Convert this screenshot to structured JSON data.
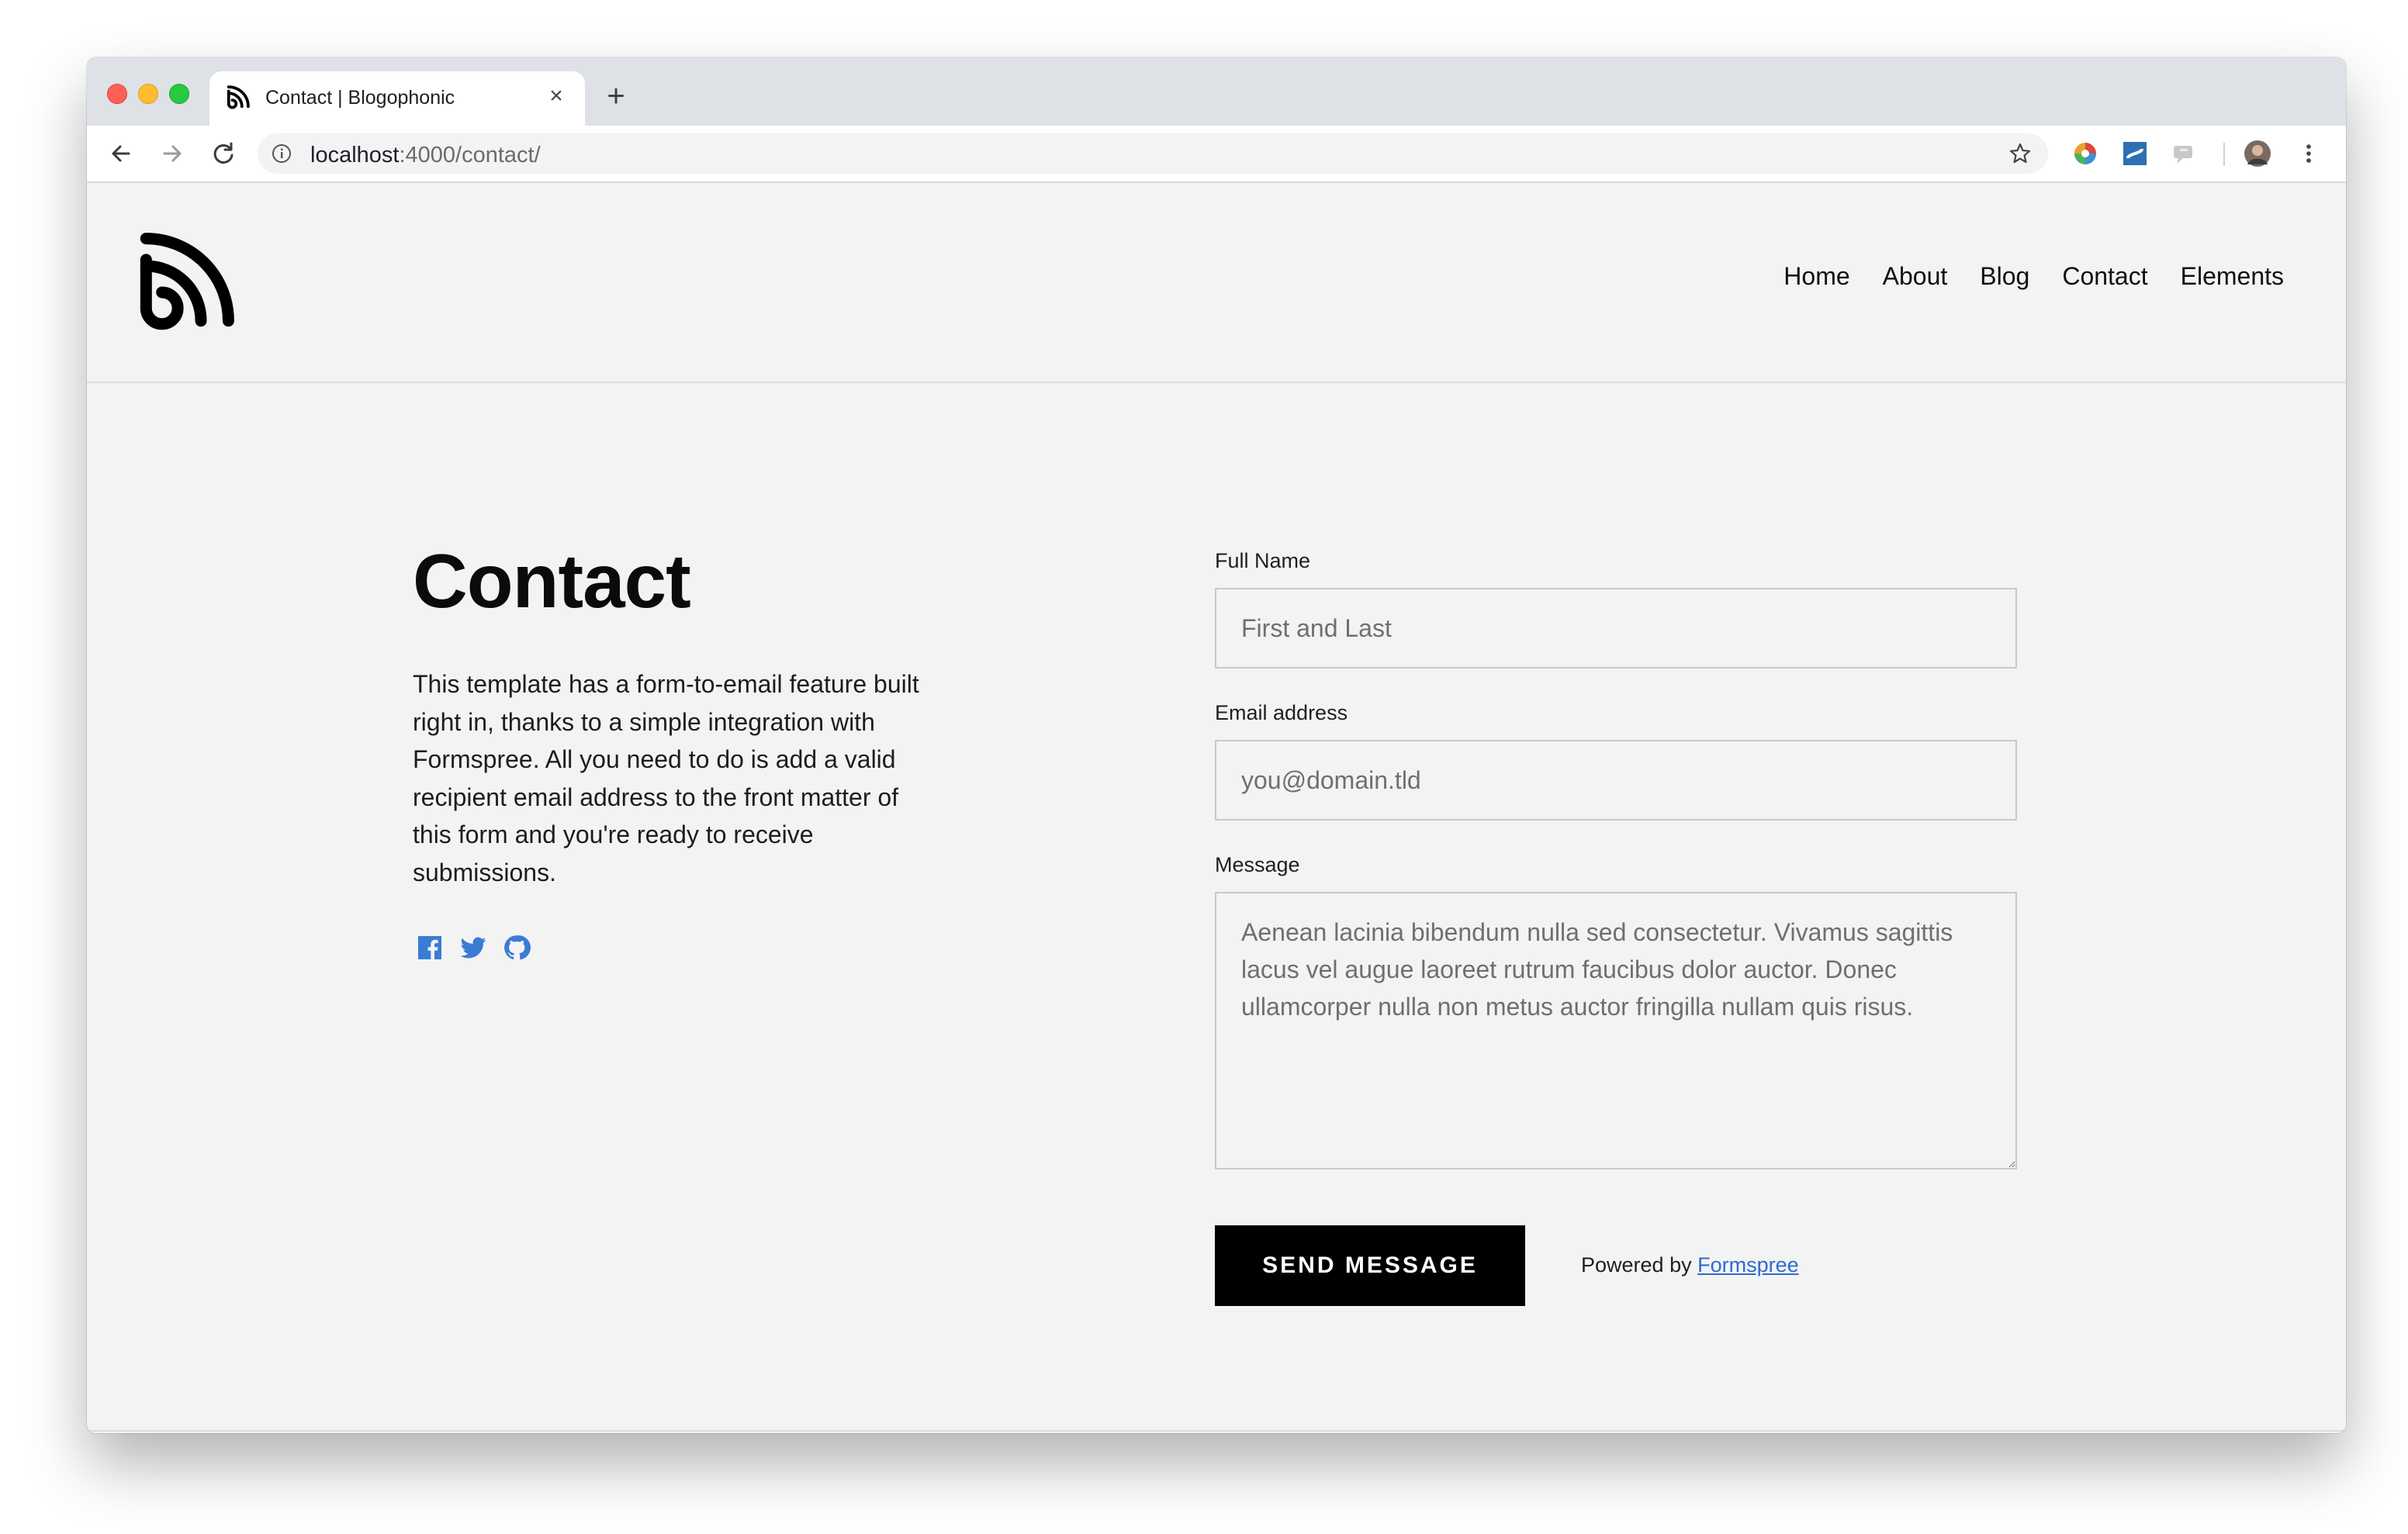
{
  "browser": {
    "tab_title": "Contact | Blogophonic",
    "url_host": "localhost",
    "url_path": ":4000/contact/"
  },
  "site": {
    "nav": [
      "Home",
      "About",
      "Blog",
      "Contact",
      "Elements"
    ]
  },
  "contact": {
    "title": "Contact",
    "body": "This template has a form-to-email feature built right in, thanks to a simple integration with Formspree. All you need to do is add a valid recipient email address to the front matter of this form and you're ready to receive submissions.",
    "social_icons": [
      "facebook-icon",
      "twitter-icon",
      "github-icon"
    ]
  },
  "form": {
    "name_label": "Full Name",
    "name_placeholder": "First and Last",
    "email_label": "Email address",
    "email_placeholder": "you@domain.tld",
    "message_label": "Message",
    "message_placeholder": "Aenean lacinia bibendum nulla sed consectetur. Vivamus sagittis lacus vel augue laoreet rutrum faucibus dolor auctor. Donec ullamcorper nulla non metus auctor fringilla nullam quis risus.",
    "submit_label": "SEND MESSAGE",
    "powered_prefix": "Powered by",
    "powered_link": "Formspree"
  },
  "colors": {
    "accent": "#3a7bd5",
    "button_bg": "#000000",
    "page_bg": "#f3f3f3"
  }
}
